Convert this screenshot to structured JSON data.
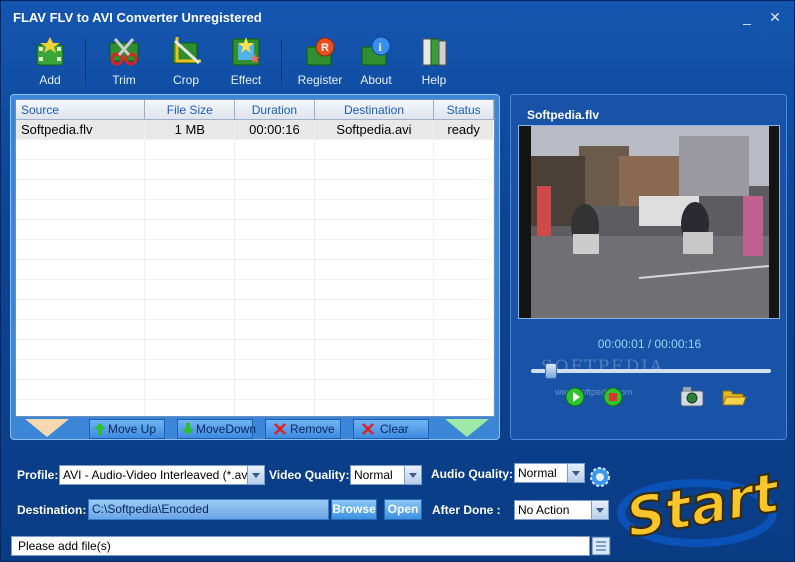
{
  "window": {
    "title": "FLAV FLV to AVI Converter Unregistered",
    "minimize": "_",
    "close": "✕"
  },
  "toolbar": {
    "add": "Add",
    "trim": "Trim",
    "crop": "Crop",
    "effect": "Effect",
    "register": "Register",
    "about": "About",
    "help": "Help"
  },
  "table": {
    "headers": [
      "Source",
      "File Size",
      "Duration",
      "Destination",
      "Status"
    ],
    "rows": [
      {
        "source": "Softpedia.flv",
        "size": "1 MB",
        "duration": "00:00:16",
        "destination": "Softpedia.avi",
        "status": "ready"
      }
    ]
  },
  "list_buttons": {
    "move_up": "Move Up",
    "move_down": "MoveDown",
    "remove": "Remove",
    "clear": "Clear"
  },
  "preview": {
    "title": "Softpedia.flv",
    "timecode": "00:00:01 / 00:00:16",
    "progress_fraction": 0.0625,
    "watermark": "SOFTPEDIA",
    "watermark_url": "www.softpedia.com"
  },
  "settings": {
    "profile_label": "Profile:",
    "profile_value": "AVI - Audio-Video Interleaved (*.avi)",
    "video_quality_label": "Video Quality:",
    "video_quality_value": "Normal",
    "audio_quality_label": "Audio Quality:",
    "audio_quality_value": "Normal",
    "destination_label": "Destination:",
    "destination_value": "C:\\Softpedia\\Encoded",
    "browse": "Browse",
    "open": "Open",
    "after_done_label": "After  Done :",
    "after_done_value": "No Action"
  },
  "status": {
    "text": "Please  add  file(s)"
  },
  "start": {
    "label": "Start"
  },
  "colors": {
    "accent": "#1456b0",
    "header_text": "#1c5cc4",
    "start_gold": "#f6c62a"
  }
}
